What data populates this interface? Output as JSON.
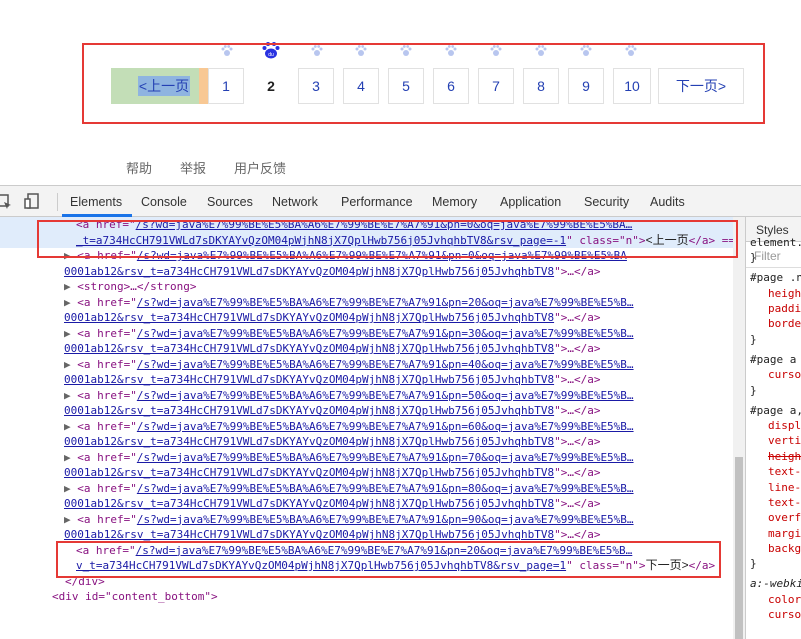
{
  "page": {
    "pager": {
      "prev_label": "<上一页",
      "next_label": "下一页>",
      "current": "2",
      "pages": [
        "1",
        "2",
        "3",
        "4",
        "5",
        "6",
        "7",
        "8",
        "9",
        "10"
      ]
    },
    "footer_links": [
      "帮助",
      "举报",
      "用户反馈"
    ]
  },
  "devtools": {
    "tabs": [
      "Elements",
      "Console",
      "Sources",
      "Network",
      "Performance",
      "Memory",
      "Application",
      "Security",
      "Audits"
    ],
    "active_tab": "Elements",
    "styles_tab": "Styles",
    "filter_placeholder": "Filter",
    "dom_lines": [
      {
        "indent": "   ",
        "arrow": "",
        "pre": "<a href=\"",
        "link": "/s?wd=java%E7%99%BE%E5%BA%A6%E7%99%BE%E7%A7%91&pn=0&oq=java%E7%99%BE%E5%BA…",
        "post": ""
      },
      {
        "indent": "   ",
        "arrow": "",
        "pre": "",
        "link": "_t=a734HcCH791VWLd7sDKYAYvQzOM04pWjhN8jX7QplHwb756j05JvhqhbTV8&rsv_page=-1",
        "post": "\" class=\"n\">",
        "text": "<上一页",
        "close": "</a> =="
      },
      {
        "indent": "  ",
        "arrow": "▶",
        "pre": "<a href=\"",
        "link": "/s?wd=java%E7%99%BE%E5%BA%A6%E7%99%BE%E7%A7%91&pn=0&oq=java%E7%99%BE%E5%BA",
        "post": ""
      },
      {
        "indent": "  ",
        "arrow": "",
        "pre": "",
        "link": "0001ab12&rsv_t=a734HcCH791VWLd7sDKYAYvQzOM04pWjhN8jX7QplHwb756j05JvhqhbTV8",
        "post": "\">…</a>"
      },
      {
        "indent": "  ",
        "arrow": "▶",
        "pre": "<strong>…</strong>",
        "link": "",
        "post": ""
      },
      {
        "indent": "  ",
        "arrow": "▶",
        "pre": "<a href=\"",
        "link": "/s?wd=java%E7%99%BE%E5%BA%A6%E7%99%BE%E7%A7%91&pn=20&oq=java%E7%99%BE%E5%B…",
        "post": ""
      },
      {
        "indent": "  ",
        "arrow": "",
        "pre": "",
        "link": "0001ab12&rsv_t=a734HcCH791VWLd7sDKYAYvQzOM04pWjhN8jX7QplHwb756j05JvhqhbTV8",
        "post": "\">…</a>"
      },
      {
        "indent": "  ",
        "arrow": "▶",
        "pre": "<a href=\"",
        "link": "/s?wd=java%E7%99%BE%E5%BA%A6%E7%99%BE%E7%A7%91&pn=30&oq=java%E7%99%BE%E5%B…",
        "post": ""
      },
      {
        "indent": "  ",
        "arrow": "",
        "pre": "",
        "link": "0001ab12&rsv_t=a734HcCH791VWLd7sDKYAYvQzOM04pWjhN8jX7QplHwb756j05JvhqhbTV8",
        "post": "\">…</a>"
      },
      {
        "indent": "  ",
        "arrow": "▶",
        "pre": "<a href=\"",
        "link": "/s?wd=java%E7%99%BE%E5%BA%A6%E7%99%BE%E7%A7%91&pn=40&oq=java%E7%99%BE%E5%B…",
        "post": ""
      },
      {
        "indent": "  ",
        "arrow": "",
        "pre": "",
        "link": "0001ab12&rsv_t=a734HcCH791VWLd7sDKYAYvQzOM04pWjhN8jX7QplHwb756j05JvhqhbTV8",
        "post": "\">…</a>"
      },
      {
        "indent": "  ",
        "arrow": "▶",
        "pre": "<a href=\"",
        "link": "/s?wd=java%E7%99%BE%E5%BA%A6%E7%99%BE%E7%A7%91&pn=50&oq=java%E7%99%BE%E5%B…",
        "post": ""
      },
      {
        "indent": "  ",
        "arrow": "",
        "pre": "",
        "link": "0001ab12&rsv_t=a734HcCH791VWLd7sDKYAYvQzOM04pWjhN8jX7QplHwb756j05JvhqhbTV8",
        "post": "\">…</a>"
      },
      {
        "indent": "  ",
        "arrow": "▶",
        "pre": "<a href=\"",
        "link": "/s?wd=java%E7%99%BE%E5%BA%A6%E7%99%BE%E7%A7%91&pn=60&oq=java%E7%99%BE%E5%B…",
        "post": ""
      },
      {
        "indent": "  ",
        "arrow": "",
        "pre": "",
        "link": "0001ab12&rsv_t=a734HcCH791VWLd7sDKYAYvQzOM04pWjhN8jX7QplHwb756j05JvhqhbTV8",
        "post": "\">…</a>"
      },
      {
        "indent": "  ",
        "arrow": "▶",
        "pre": "<a href=\"",
        "link": "/s?wd=java%E7%99%BE%E5%BA%A6%E7%99%BE%E7%A7%91&pn=70&oq=java%E7%99%BE%E5%B…",
        "post": ""
      },
      {
        "indent": "  ",
        "arrow": "",
        "pre": "",
        "link": "0001ab12&rsv_t=a734HcCH791VWLd7sDKYAYvQzOM04pWjhN8jX7QplHwb756j05JvhqhbTV8",
        "post": "\">…</a>"
      },
      {
        "indent": "  ",
        "arrow": "▶",
        "pre": "<a href=\"",
        "link": "/s?wd=java%E7%99%BE%E5%BA%A6%E7%99%BE%E7%A7%91&pn=80&oq=java%E7%99%BE%E5%B…",
        "post": ""
      },
      {
        "indent": "  ",
        "arrow": "",
        "pre": "",
        "link": "0001ab12&rsv_t=a734HcCH791VWLd7sDKYAYvQzOM04pWjhN8jX7QplHwb756j05JvhqhbTV8",
        "post": "\">…</a>"
      },
      {
        "indent": "  ",
        "arrow": "▶",
        "pre": "<a href=\"",
        "link": "/s?wd=java%E7%99%BE%E5%BA%A6%E7%99%BE%E7%A7%91&pn=90&oq=java%E7%99%BE%E5%B…",
        "post": ""
      },
      {
        "indent": "  ",
        "arrow": "",
        "pre": "",
        "link": "0001ab12&rsv_t=a734HcCH791VWLd7sDKYAYvQzOM04pWjhN8jX7QplHwb756j05JvhqhbTV8",
        "post": "\">…</a>"
      },
      {
        "indent": "   ",
        "arrow": "",
        "pre": "<a href=\"",
        "link": "/s?wd=java%E7%99%BE%E5%BA%A6%E7%99%BE%E7%A7%91&pn=20&oq=java%E7%99%BE%E5%B…",
        "post": ""
      },
      {
        "indent": "   ",
        "arrow": "",
        "pre": "",
        "link": "v_t=a734HcCH791VWLd7sDKYAYvQzOM04pWjhN8jX7QplHwb756j05JvhqhbTV8&rsv_page=1",
        "post": "\" class=\"n\">",
        "text": "下一页>",
        "close": "</a>"
      },
      {
        "indent": "  ",
        "arrow": "",
        "pre": "</div>",
        "link": "",
        "post": ""
      },
      {
        "indent": " ",
        "arrow": "",
        "pre": "<div id=\"content_bottom\">",
        "link": "",
        "post": ""
      }
    ],
    "styles_lines": [
      {
        "kind": "sel",
        "text": "element.st"
      },
      {
        "kind": "sel",
        "text": "}"
      },
      {
        "kind": "sel",
        "text": "#page .n"
      },
      {
        "kind": "prop",
        "text": "height"
      },
      {
        "kind": "prop",
        "text": "padding"
      },
      {
        "kind": "prop",
        "text": "border"
      },
      {
        "kind": "sel",
        "text": "}"
      },
      {
        "kind": "sel",
        "text": "#page a"
      },
      {
        "kind": "prop",
        "text": "cursor"
      },
      {
        "kind": "sel",
        "text": "}"
      },
      {
        "kind": "sel",
        "text": "#page a,"
      },
      {
        "kind": "prop",
        "text": "display"
      },
      {
        "kind": "prop",
        "text": "vertical"
      },
      {
        "kind": "strike",
        "text": "height"
      },
      {
        "kind": "prop",
        "text": "text-"
      },
      {
        "kind": "prop",
        "text": "line-"
      },
      {
        "kind": "prop",
        "text": "text-"
      },
      {
        "kind": "prop",
        "text": "overflow"
      },
      {
        "kind": "prop",
        "text": "margin"
      },
      {
        "kind": "prop",
        "text": "background"
      },
      {
        "kind": "sel",
        "text": "}"
      },
      {
        "kind": "sel",
        "text": "a:-webkit"
      },
      {
        "kind": "prop",
        "text": "color"
      },
      {
        "kind": "prop",
        "text": "cursor"
      }
    ]
  }
}
